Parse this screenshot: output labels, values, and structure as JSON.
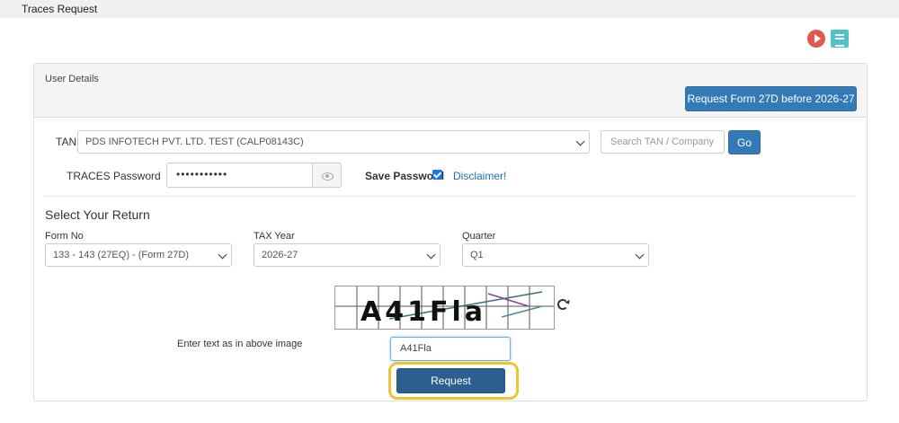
{
  "window": {
    "title": "Traces Request"
  },
  "icons": {
    "help_video": "play-icon",
    "help_doc": "document-icon"
  },
  "panel": {
    "header_label": "User Details",
    "request_27d_button": "Request Form 27D before 2026-27"
  },
  "tan": {
    "label": "TAN",
    "selected": "PDS INFOTECH PVT. LTD. TEST (CALP08143C)",
    "search_placeholder": "Search TAN / Company",
    "go_button": "Go"
  },
  "password": {
    "label": "TRACES Password",
    "value": "•••••••••••",
    "save_label": "Save Password",
    "save_checked": true,
    "disclaimer_link": "Disclaimer!"
  },
  "return": {
    "section_title": "Select Your Return",
    "form_no": {
      "label": "Form No",
      "selected": "133 - 143 (27EQ) - (Form 27D)"
    },
    "tax_year": {
      "label": "TAX Year",
      "selected": "2026-27"
    },
    "quarter": {
      "label": "Quarter",
      "selected": "Q1"
    }
  },
  "captcha": {
    "image_text": "A41Fla",
    "prompt": "Enter text as in above image",
    "value": "A41Fla"
  },
  "request_button": "Request",
  "colors": {
    "primary": "#337ab7",
    "request_button": "#2a5f8e",
    "highlight": "#f0c430"
  }
}
